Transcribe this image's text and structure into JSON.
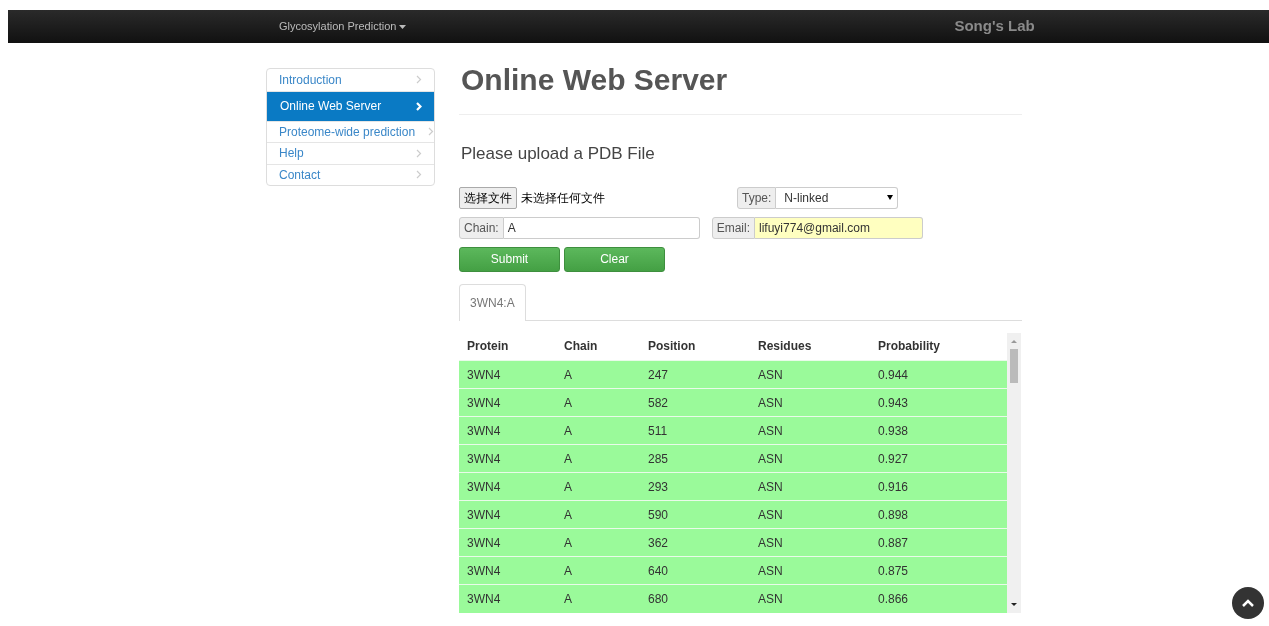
{
  "navbar": {
    "menu": "Glycosylation Prediction",
    "brand": "Song's Lab"
  },
  "sidebar": {
    "items": [
      {
        "label": "Introduction",
        "selected": false
      },
      {
        "label": "Online Web Server",
        "selected": true
      },
      {
        "label": "Proteome-wide prediction",
        "selected": false
      },
      {
        "label": "Help",
        "selected": false
      },
      {
        "label": "Contact",
        "selected": false
      }
    ]
  },
  "title": "Online Web Server",
  "subtitle": "Please upload a PDB File",
  "form": {
    "file_button": "选择文件",
    "file_status": "未选择任何文件",
    "type_label": "Type:",
    "type_value": "N-linked",
    "chain_label": "Chain:",
    "chain_value": "A",
    "email_label": "Email:",
    "email_value": "lifuyi774@gmail.com",
    "buttons": [
      "Submit",
      "Clear"
    ]
  },
  "tabs": [
    {
      "label": "3WN4:A",
      "selected": true
    }
  ],
  "table": {
    "columns": [
      "Protein",
      "Chain",
      "Position",
      "Residues",
      "Probability"
    ],
    "rows": [
      [
        "3WN4",
        "A",
        "247",
        "ASN",
        "0.944"
      ],
      [
        "3WN4",
        "A",
        "582",
        "ASN",
        "0.943"
      ],
      [
        "3WN4",
        "A",
        "511",
        "ASN",
        "0.938"
      ],
      [
        "3WN4",
        "A",
        "285",
        "ASN",
        "0.927"
      ],
      [
        "3WN4",
        "A",
        "293",
        "ASN",
        "0.916"
      ],
      [
        "3WN4",
        "A",
        "590",
        "ASN",
        "0.898"
      ],
      [
        "3WN4",
        "A",
        "362",
        "ASN",
        "0.887"
      ],
      [
        "3WN4",
        "A",
        "640",
        "ASN",
        "0.875"
      ],
      [
        "3WN4",
        "A",
        "680",
        "ASN",
        "0.866"
      ]
    ]
  }
}
